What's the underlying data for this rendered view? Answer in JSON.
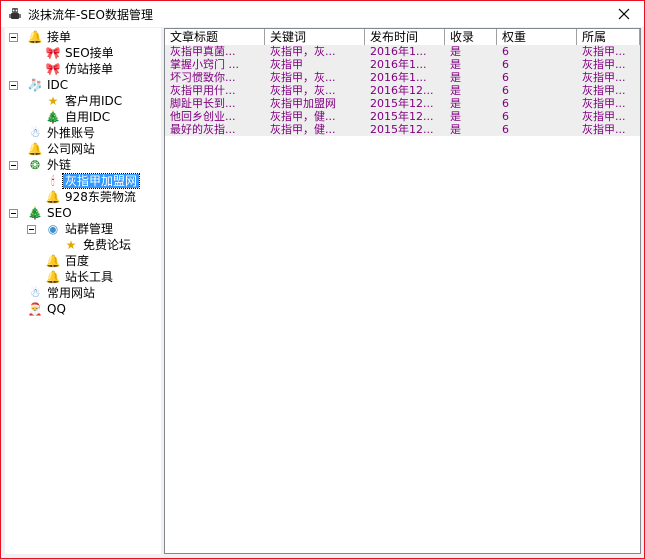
{
  "window": {
    "title": "淡抹流年-SEO数据管理",
    "app_icon": "robot-icon",
    "close_icon": "close-icon",
    "border_color": "#e81123"
  },
  "tree": {
    "items": [
      {
        "id": "jiedan",
        "label": "接单",
        "level": 0,
        "icon": "bell-icon",
        "expanded": true
      },
      {
        "id": "seo-jiedan",
        "label": "SEO接单",
        "level": 1,
        "icon": "ribbon-icon"
      },
      {
        "id": "fangzhan-jiedan",
        "label": "仿站接单",
        "level": 1,
        "icon": "ribbon-icon"
      },
      {
        "id": "idc",
        "label": "IDC",
        "level": 0,
        "icon": "stocking-icon",
        "expanded": true
      },
      {
        "id": "kehu-idc",
        "label": "客户用IDC",
        "level": 1,
        "icon": "star-icon"
      },
      {
        "id": "ziyong-idc",
        "label": "自用IDC",
        "level": 1,
        "icon": "tree-icon"
      },
      {
        "id": "waitui",
        "label": "外推账号",
        "level": 0,
        "icon": "snowman-icon"
      },
      {
        "id": "gongsi",
        "label": "公司网站",
        "level": 0,
        "icon": "bells-icon"
      },
      {
        "id": "wailian",
        "label": "外链",
        "level": 0,
        "icon": "wreath-icon",
        "expanded": true
      },
      {
        "id": "huizhijia",
        "label": "灰指甲加盟网",
        "level": 1,
        "icon": "candle-icon",
        "selected": true
      },
      {
        "id": "dongguan",
        "label": "928东莞物流",
        "level": 1,
        "icon": "bells-icon"
      },
      {
        "id": "seo",
        "label": "SEO",
        "level": 0,
        "icon": "tree-icon",
        "expanded": true
      },
      {
        "id": "zhanqun",
        "label": "站群管理",
        "level": 1,
        "icon": "globe-icon",
        "expanded": true
      },
      {
        "id": "mianfei",
        "label": "免费论坛",
        "level": 2,
        "icon": "star-icon"
      },
      {
        "id": "baidu",
        "label": "百度",
        "level": 1,
        "icon": "bells-icon"
      },
      {
        "id": "zhanzhang",
        "label": "站长工具",
        "level": 1,
        "icon": "bell-icon"
      },
      {
        "id": "changyong",
        "label": "常用网站",
        "level": 0,
        "icon": "snowman-icon"
      },
      {
        "id": "qq",
        "label": "QQ",
        "level": 0,
        "icon": "santa-icon"
      }
    ]
  },
  "list": {
    "columns": [
      "文章标题",
      "关键词",
      "发布时间",
      "收录",
      "权重",
      "所属"
    ],
    "rows": [
      [
        "灰指甲真菌...",
        "灰指甲，灰...",
        "2016年1...",
        "是",
        "6",
        "灰指甲..."
      ],
      [
        "掌握小窍门 ...",
        "灰指甲",
        "2016年1...",
        "是",
        "6",
        "灰指甲..."
      ],
      [
        "坏习惯致你...",
        "灰指甲，灰...",
        "2016年1...",
        "是",
        "6",
        "灰指甲..."
      ],
      [
        "灰指甲用什...",
        "灰指甲，灰...",
        "2016年12...",
        "是",
        "6",
        "灰指甲..."
      ],
      [
        "脚趾甲长到...",
        "灰指甲加盟网",
        "2015年12...",
        "是",
        "6",
        "灰指甲..."
      ],
      [
        "他回乡创业...",
        "灰指甲，健...",
        "2015年12...",
        "是",
        "6",
        "灰指甲..."
      ],
      [
        "最好的灰指...",
        "灰指甲，健...",
        "2015年12...",
        "是",
        "6",
        "灰指甲..."
      ]
    ],
    "text_color": "#800080",
    "row_bg": "#eeeeee"
  }
}
